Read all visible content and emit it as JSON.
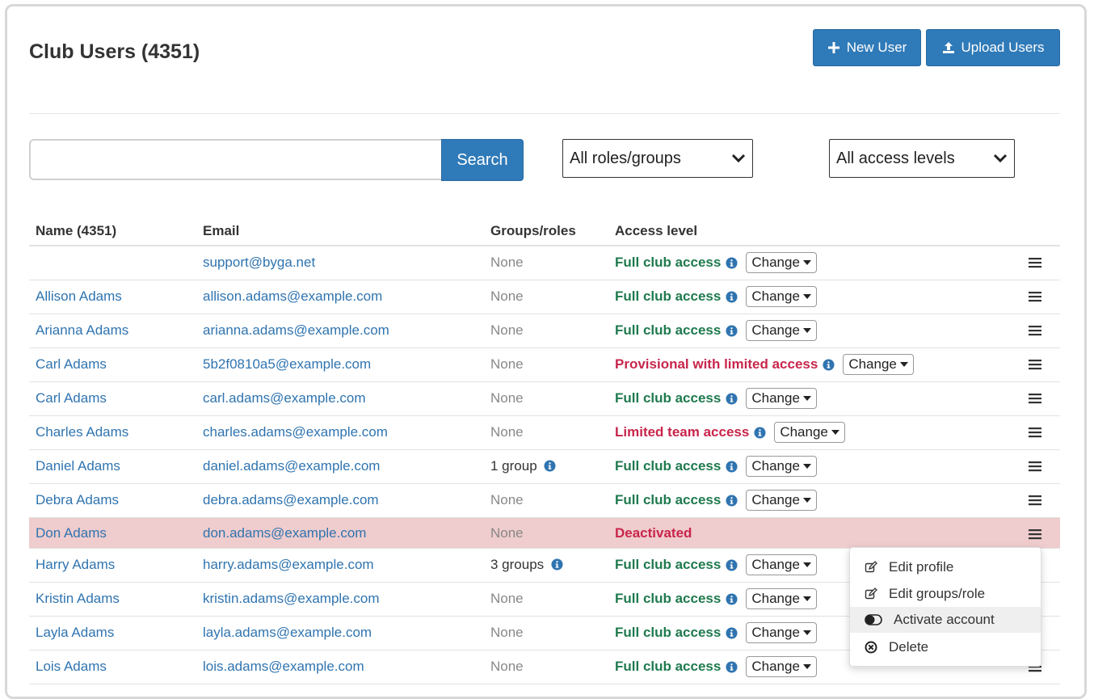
{
  "page": {
    "title": "Club Users (4351)",
    "new_user_label": "New User",
    "upload_users_label": "Upload Users"
  },
  "filters": {
    "search_value": "",
    "search_placeholder": "",
    "search_label": "Search",
    "roles_selected": "All roles/groups",
    "access_selected": "All access levels"
  },
  "table": {
    "headers": {
      "name": "Name (4351)",
      "email": "Email",
      "groups": "Groups/roles",
      "access": "Access level"
    },
    "change_label": "Change",
    "rows": [
      {
        "name": "",
        "email": "support@byga.net",
        "groups": "None",
        "groups_info": false,
        "access": "Full club access",
        "access_type": "full",
        "deactivated": false
      },
      {
        "name": "Allison Adams",
        "email": "allison.adams@example.com",
        "groups": "None",
        "groups_info": false,
        "access": "Full club access",
        "access_type": "full",
        "deactivated": false
      },
      {
        "name": "Arianna Adams",
        "email": "arianna.adams@example.com",
        "groups": "None",
        "groups_info": false,
        "access": "Full club access",
        "access_type": "full",
        "deactivated": false
      },
      {
        "name": "Carl Adams",
        "email": "5b2f0810a5@example.com",
        "groups": "None",
        "groups_info": false,
        "access": "Provisional with limited access",
        "access_type": "limited",
        "deactivated": false
      },
      {
        "name": "Carl Adams",
        "email": "carl.adams@example.com",
        "groups": "None",
        "groups_info": false,
        "access": "Full club access",
        "access_type": "full",
        "deactivated": false
      },
      {
        "name": "Charles Adams",
        "email": "charles.adams@example.com",
        "groups": "None",
        "groups_info": false,
        "access": "Limited team access",
        "access_type": "limited",
        "deactivated": false
      },
      {
        "name": "Daniel Adams",
        "email": "daniel.adams@example.com",
        "groups": "1 group",
        "groups_info": true,
        "access": "Full club access",
        "access_type": "full",
        "deactivated": false
      },
      {
        "name": "Debra Adams",
        "email": "debra.adams@example.com",
        "groups": "None",
        "groups_info": false,
        "access": "Full club access",
        "access_type": "full",
        "deactivated": false
      },
      {
        "name": "Don Adams",
        "email": "don.adams@example.com",
        "groups": "None",
        "groups_info": false,
        "access": "Deactivated",
        "access_type": "deactivated",
        "deactivated": true
      },
      {
        "name": "Harry Adams",
        "email": "harry.adams@example.com",
        "groups": "3 groups",
        "groups_info": true,
        "access": "Full club access",
        "access_type": "full",
        "deactivated": false
      },
      {
        "name": "Kristin Adams",
        "email": "kristin.adams@example.com",
        "groups": "None",
        "groups_info": false,
        "access": "Full club access",
        "access_type": "full",
        "deactivated": false
      },
      {
        "name": "Layla Adams",
        "email": "layla.adams@example.com",
        "groups": "None",
        "groups_info": false,
        "access": "Full club access",
        "access_type": "full",
        "deactivated": false
      },
      {
        "name": "Lois Adams",
        "email": "lois.adams@example.com",
        "groups": "None",
        "groups_info": false,
        "access": "Full club access",
        "access_type": "full",
        "deactivated": false
      }
    ]
  },
  "row_menu": {
    "items": [
      {
        "label": "Edit profile",
        "icon": "edit-icon"
      },
      {
        "label": "Edit groups/role",
        "icon": "edit-icon"
      },
      {
        "label": "Activate account",
        "icon": "toggle-icon"
      },
      {
        "label": "Delete",
        "icon": "delete-circle-icon"
      }
    ]
  },
  "colors": {
    "primary": "#2f7ab8",
    "link": "#2f74b0",
    "full_access": "#1f7a4e",
    "limited_access": "#c8254b",
    "deactivated_row": "#efcccd"
  }
}
